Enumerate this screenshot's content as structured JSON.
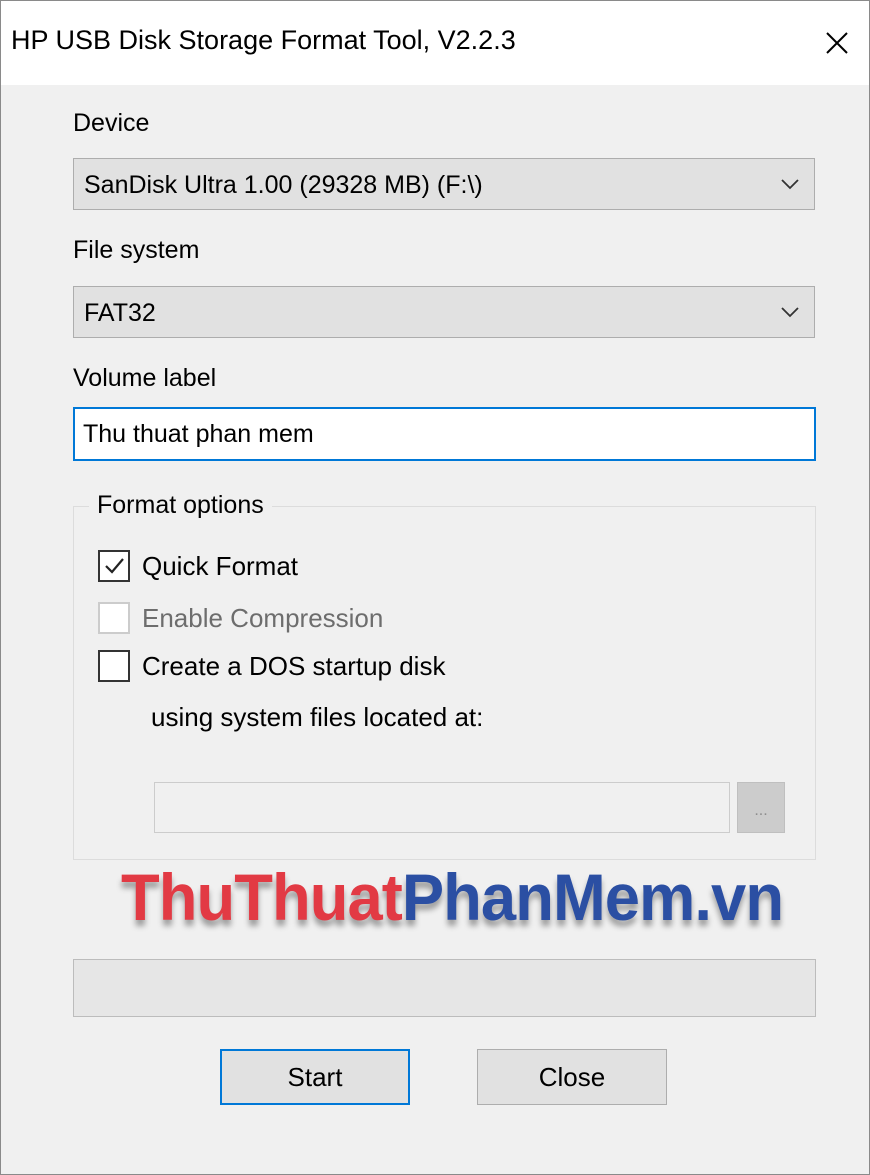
{
  "window": {
    "title": "HP USB Disk Storage Format Tool, V2.2.3"
  },
  "device": {
    "label": "Device",
    "selected": "SanDisk Ultra 1.00 (29328 MB) (F:\\)"
  },
  "file_system": {
    "label": "File system",
    "selected": "FAT32"
  },
  "volume_label": {
    "label": "Volume label",
    "value": "Thu thuat phan mem"
  },
  "format_options": {
    "legend": "Format options",
    "quick_format": {
      "label": "Quick Format",
      "checked": true
    },
    "enable_compression": {
      "label": "Enable Compression",
      "checked": false,
      "enabled": false
    },
    "dos_startup": {
      "label": "Create a DOS startup disk",
      "sublabel": "using system files located at:",
      "checked": false
    },
    "browse_label": "..."
  },
  "watermark": {
    "part1": "ThuThuat",
    "part2": "PhanMem.vn"
  },
  "buttons": {
    "start": "Start",
    "close": "Close"
  },
  "colors": {
    "accent": "#0078d7",
    "watermark_red": "#e23a44",
    "watermark_blue": "#2b4fa3"
  },
  "icons": {
    "close": "close-icon",
    "dropdown": "chevron-down-icon",
    "check": "checkmark-icon"
  }
}
